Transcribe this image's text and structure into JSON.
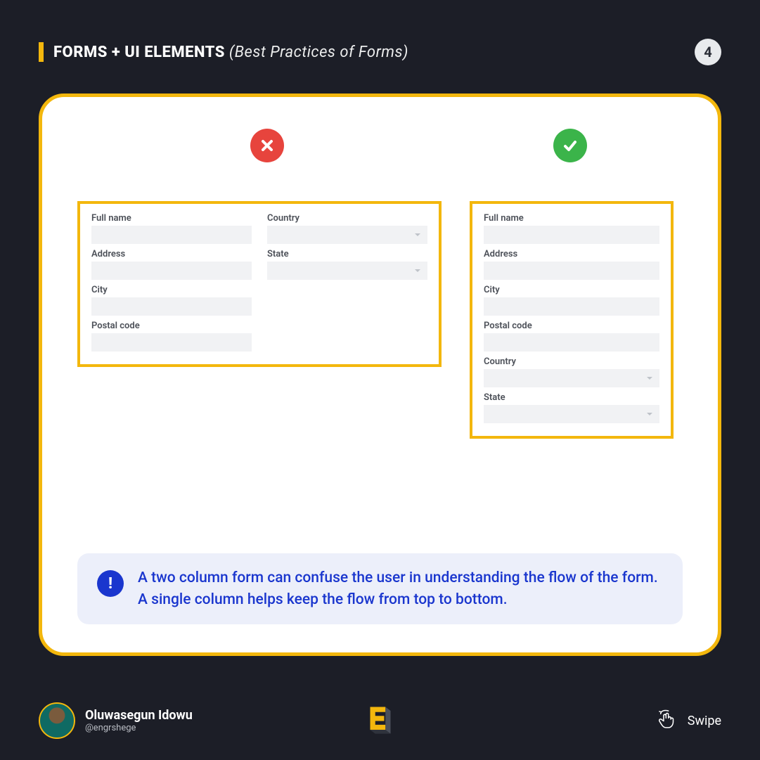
{
  "header": {
    "title_main": "FORMS + UI ELEMENTS",
    "title_sub": "(Best Practices of Forms)",
    "page_number": "4"
  },
  "forms": {
    "bad": {
      "col1": [
        {
          "label": "Full name",
          "type": "text"
        },
        {
          "label": "Address",
          "type": "text"
        },
        {
          "label": "City",
          "type": "text"
        },
        {
          "label": "Postal code",
          "type": "text"
        }
      ],
      "col2": [
        {
          "label": "Country",
          "type": "select"
        },
        {
          "label": "State",
          "type": "select"
        }
      ]
    },
    "good": [
      {
        "label": "Full name",
        "type": "text"
      },
      {
        "label": "Address",
        "type": "text"
      },
      {
        "label": "City",
        "type": "text"
      },
      {
        "label": "Postal code",
        "type": "text"
      },
      {
        "label": "Country",
        "type": "select"
      },
      {
        "label": "State",
        "type": "select"
      }
    ]
  },
  "note": {
    "icon": "!",
    "text": "A two column form can confuse the user in understanding the flow of the form. A single column helps keep the flow from top to bottom."
  },
  "footer": {
    "author_name": "Oluwasegun Idowu",
    "author_handle": "@engrshege",
    "swipe_label": "Swipe"
  }
}
